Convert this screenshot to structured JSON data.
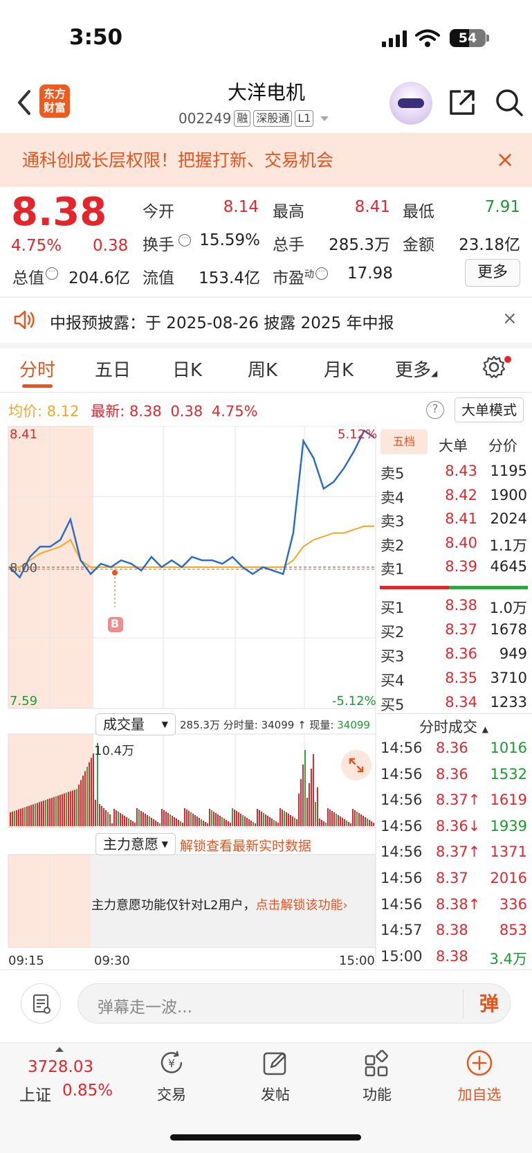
{
  "status_bar": {
    "time": "3:50",
    "battery": "54",
    "battery_level": 0.54
  },
  "header": {
    "logo_text": "东方财富",
    "stock_name": "大洋电机",
    "stock_code": "002249",
    "tags": [
      "融",
      "深股通",
      "L1"
    ]
  },
  "banner": {
    "text": "通科创成长层权限！把握打新、交易机会",
    "close": "×"
  },
  "quote": {
    "price": "8.38",
    "change_pct": "4.75%",
    "change": "0.38",
    "stats": [
      {
        "label": "今开",
        "value": "8.14",
        "color": "red"
      },
      {
        "label": "最高",
        "value": "8.41",
        "color": "red"
      },
      {
        "label": "最低",
        "value": "7.91",
        "color": "green"
      },
      {
        "label": "换手",
        "value": "15.59%",
        "color": "black"
      },
      {
        "label": "总手",
        "value": "285.3万",
        "color": "black"
      },
      {
        "label": "金额",
        "value": "23.18亿",
        "color": "black"
      },
      {
        "label": "总值",
        "value": "204.6亿",
        "color": "black"
      },
      {
        "label": "流值",
        "value": "153.4亿",
        "color": "black"
      },
      {
        "label": "市盈",
        "sup": "动",
        "value": "17.98",
        "color": "black"
      }
    ],
    "more_label": "更多"
  },
  "notice": {
    "text": "中报预披露：于 2025-08-26 披露 2025 年中报",
    "close": "×"
  },
  "tabs": [
    "分时",
    "五日",
    "日K",
    "周K",
    "月K",
    "更多"
  ],
  "info_line": {
    "avg_label": "均价:",
    "avg_value": "8.12",
    "latest_label": "最新:",
    "latest_value": "8.38",
    "change": "0.38",
    "change_pct": "4.75%"
  },
  "help": "?",
  "bigorder_label": "大单模式",
  "chart": {
    "y_high": "8.41",
    "y_low": "7.59",
    "y_mid": "8.00",
    "pct_high": "5.12%",
    "pct_low": "-5.12%",
    "marker": "B",
    "vol_peak_label": "10.4万",
    "x_labels": [
      "09:15",
      "09:30",
      "15:00"
    ]
  },
  "chart_data": {
    "type": "line",
    "ylim": [
      7.59,
      8.41
    ],
    "series": [
      {
        "name": "最新",
        "color": "#2b6cc4",
        "values": [
          8.0,
          7.97,
          8.03,
          8.06,
          8.06,
          8.08,
          8.14,
          8.02,
          7.98,
          8.01,
          8.0,
          8.02,
          8.01,
          7.99,
          8.03,
          8.0,
          8.02,
          8.0,
          8.03,
          8.02,
          8.02,
          8.01,
          8.03,
          8.0,
          7.98,
          8.0,
          7.99,
          7.98,
          8.1,
          8.37,
          8.32,
          8.23,
          8.25,
          8.29,
          8.34,
          8.4,
          8.38
        ]
      },
      {
        "name": "均价",
        "color": "#f5a623",
        "values": [
          8.0,
          8.0,
          8.02,
          8.04,
          8.05,
          8.06,
          8.08,
          8.02,
          8.0,
          8.0,
          8.0,
          8.0,
          8.0,
          8.0,
          8.0,
          8.0,
          8.0,
          8.0,
          8.0,
          8.0,
          8.0,
          8.0,
          8.0,
          8.0,
          8.0,
          8.0,
          8.0,
          8.0,
          8.02,
          8.06,
          8.08,
          8.09,
          8.1,
          8.1,
          8.11,
          8.12,
          8.12
        ]
      }
    ]
  },
  "volume": {
    "select_label": "成交量",
    "total": "285.3万",
    "per_min_label": "分时量:",
    "per_min": "34099",
    "now_label": "现量:",
    "now": "34099"
  },
  "main_force": {
    "select_label": "主力意愿",
    "unlock_link": "解锁查看最新实时数据",
    "l2_text": "主力意愿功能仅针对L2用户，",
    "l2_link": "点击解锁该功能"
  },
  "order_book": {
    "tabs": [
      "五档",
      "大单",
      "分价"
    ],
    "asks": [
      {
        "label": "卖5",
        "price": "8.43",
        "vol": "1195"
      },
      {
        "label": "卖4",
        "price": "8.42",
        "vol": "1900"
      },
      {
        "label": "卖3",
        "price": "8.41",
        "vol": "2024"
      },
      {
        "label": "卖2",
        "price": "8.40",
        "vol": "1.1万"
      },
      {
        "label": "卖1",
        "price": "8.39",
        "vol": "4645"
      }
    ],
    "bids": [
      {
        "label": "买1",
        "price": "8.38",
        "vol": "1.0万"
      },
      {
        "label": "买2",
        "price": "8.37",
        "vol": "1678"
      },
      {
        "label": "买3",
        "price": "8.36",
        "vol": "949"
      },
      {
        "label": "买4",
        "price": "8.35",
        "vol": "3710"
      },
      {
        "label": "买5",
        "price": "8.34",
        "vol": "1233"
      }
    ]
  },
  "ticks": {
    "header": "分时成交",
    "rows": [
      {
        "time": "14:56",
        "price": "8.36",
        "vol": "1016",
        "color": "green"
      },
      {
        "time": "14:56",
        "price": "8.36",
        "vol": "1532",
        "color": "green"
      },
      {
        "time": "14:56",
        "price": "8.37↑",
        "vol": "1619",
        "color": "red"
      },
      {
        "time": "14:56",
        "price": "8.36↓",
        "vol": "1939",
        "color": "green"
      },
      {
        "time": "14:56",
        "price": "8.37↑",
        "vol": "1371",
        "color": "red"
      },
      {
        "time": "14:56",
        "price": "8.37",
        "vol": "2016",
        "color": "red"
      },
      {
        "time": "14:56",
        "price": "8.38↑",
        "vol": "336",
        "color": "red"
      },
      {
        "time": "14:57",
        "price": "8.38",
        "vol": "853",
        "color": "red"
      },
      {
        "time": "15:00",
        "price": "8.38",
        "vol": "3.4万",
        "color": "green"
      }
    ]
  },
  "comment_bar": {
    "placeholder": "弹幕走一波...",
    "send_label": "弹"
  },
  "bottom_nav": {
    "index_value": "3728.03",
    "index_name": "上证",
    "index_pct": "0.85%",
    "items": [
      "交易",
      "发帖",
      "功能",
      "加自选"
    ]
  }
}
